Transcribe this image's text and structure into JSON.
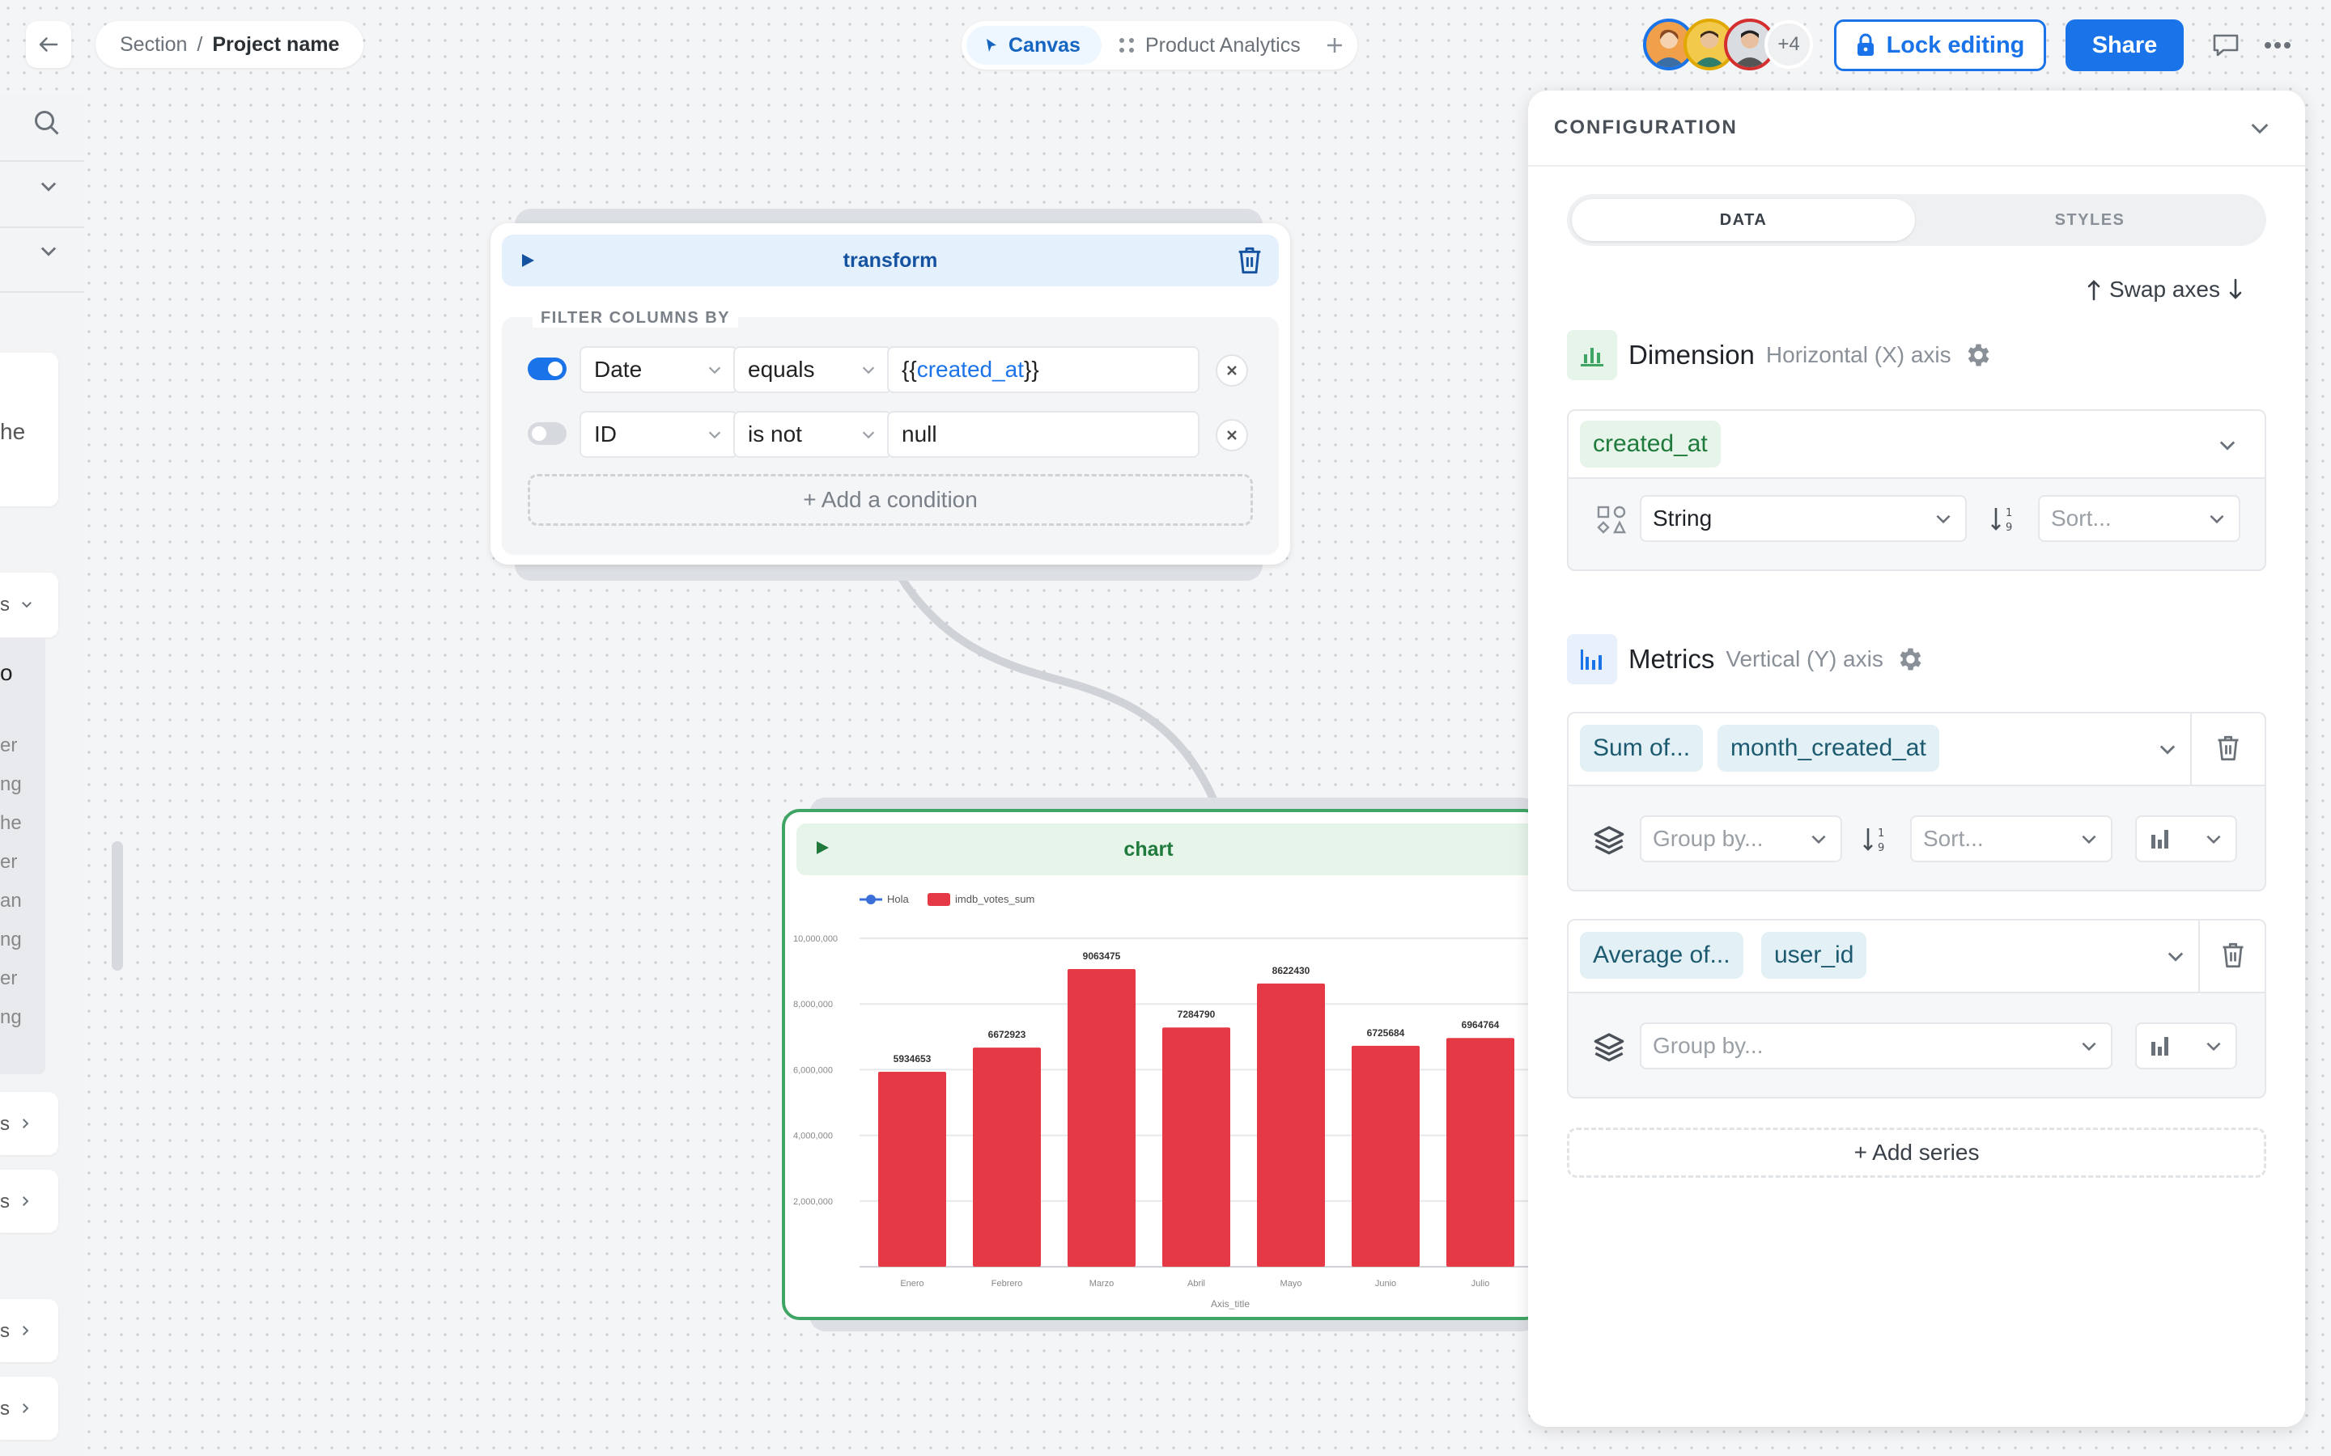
{
  "header": {
    "breadcrumb_section": "Section",
    "breadcrumb_sep": "/",
    "breadcrumb_project": "Project name",
    "tab_canvas": "Canvas",
    "tab_product": "Product Analytics",
    "avatar_more": "+4",
    "lock_label": "Lock editing",
    "share_label": "Share"
  },
  "sidebar": {
    "partial_texts": [
      "he",
      "s",
      "o",
      "er",
      "ng",
      "he",
      "er",
      "an",
      "ng",
      "er",
      "ng",
      "s",
      "s",
      "s",
      "s"
    ]
  },
  "transform_node": {
    "title": "transform",
    "filter_label": "FILTER COLUMNS BY",
    "conditions": [
      {
        "enabled": true,
        "column": "Date",
        "operator": "equals",
        "value_prefix": "{{",
        "value_var": "created_at",
        "value_suffix": "}}"
      },
      {
        "enabled": false,
        "column": "ID",
        "operator": "is not",
        "value": "null"
      }
    ],
    "add_condition": "+ Add a condition"
  },
  "chart_node": {
    "title": "chart"
  },
  "chart_data": {
    "type": "bar",
    "categories": [
      "Enero",
      "Febrero",
      "Marzo",
      "Abril",
      "Mayo",
      "Junio",
      "Julio"
    ],
    "series": [
      {
        "name": "imdb_votes_sum",
        "values": [
          5934653,
          6672923,
          9063475,
          7284790,
          8622430,
          6725684,
          6964764
        ]
      }
    ],
    "legend": [
      "Hola",
      "imdb_votes_sum"
    ],
    "legend_position": "top-left",
    "xlabel": "Axis_title",
    "ylabel": "",
    "ylim": [
      0,
      10000000
    ],
    "y_ticks": [
      "2,000,000",
      "4,000,000",
      "6,000,000",
      "8,000,000",
      "10,000,000"
    ],
    "data_labels": [
      "5934653",
      "6672923",
      "9063475",
      "7284790",
      "8622430",
      "6725684",
      "6964764"
    ],
    "grid": true,
    "colors": {
      "bar": "#e63946",
      "legend_line": "#3b6fd8"
    }
  },
  "config_panel": {
    "title": "CONFIGURATION",
    "tab_data": "DATA",
    "tab_styles": "STYLES",
    "swap_axes": "Swap axes",
    "dimension": {
      "title": "Dimension",
      "subtitle": "Horizontal (X) axis",
      "field": "created_at",
      "type": "String",
      "sort_placeholder": "Sort..."
    },
    "metrics": {
      "title": "Metrics",
      "subtitle": "Vertical (Y) axis",
      "items": [
        {
          "agg": "Sum of...",
          "field": "month_created_at",
          "group_placeholder": "Group by...",
          "sort_placeholder": "Sort..."
        },
        {
          "agg": "Average of...",
          "field": "user_id",
          "group_placeholder": "Group by..."
        }
      ]
    },
    "add_series": "+ Add series"
  },
  "colors": {
    "accent": "#1a73e8",
    "chart_green": "#3fa565",
    "dimension_chip": "#e6f4ea",
    "metric_chip": "#e3f1f6"
  }
}
